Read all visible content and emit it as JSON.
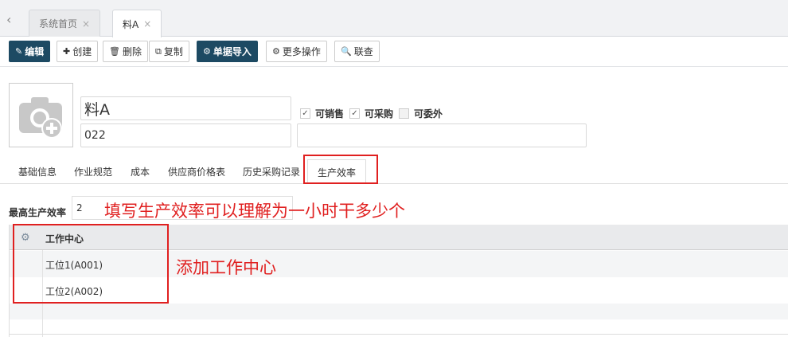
{
  "tabs": [
    {
      "label": "系统首页",
      "close": "×"
    },
    {
      "label": "料A",
      "close": "×"
    }
  ],
  "toolbar": {
    "edit": "编辑",
    "create": "创建",
    "delete": "删除",
    "copy": "复制",
    "import": "单据导入",
    "more": "更多操作",
    "lookup": "联查"
  },
  "product": {
    "name": "料A",
    "code": "022",
    "extra": ""
  },
  "options": {
    "sale": "可销售",
    "purchase": "可采购",
    "outsource": "可委外"
  },
  "form_tabs": [
    "基础信息",
    "作业规范",
    "成本",
    "供应商价格表",
    "历史采购记录",
    "生产效率"
  ],
  "efficiency": {
    "label": "最高生产效率",
    "value": "2"
  },
  "table": {
    "column": "工作中心",
    "rows": [
      "工位1(A001)",
      "工位2(A002)"
    ]
  },
  "annotations": {
    "efficiency_note": "填写生产效率可以理解为一小时干多少个",
    "workcenter_note": "添加工作中心"
  },
  "colors": {
    "primary_button": "#1d4a63",
    "annotation": "#e02020"
  }
}
